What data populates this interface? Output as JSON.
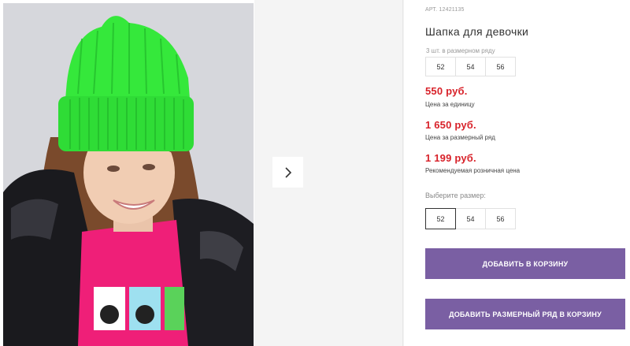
{
  "product": {
    "sku": "АРТ. 12421135",
    "title": "Шапка для девочки"
  },
  "size_set": {
    "caption": "3 шт. в размерном ряду",
    "sizes": [
      "52",
      "54",
      "56"
    ]
  },
  "prices": [
    {
      "value": "550 руб.",
      "note": "Цена за единицу"
    },
    {
      "value": "1 650 руб.",
      "note": "Цена за размерный ряд"
    },
    {
      "value": "1 199 руб.",
      "note": "Рекомендуемая розничная цена"
    }
  ],
  "size_picker": {
    "label": "Выберите размер:",
    "sizes": [
      "52",
      "54",
      "56"
    ],
    "selected": "52"
  },
  "buttons": {
    "add_to_cart": "ДОБАВИТЬ В КОРЗИНУ",
    "add_set_to_cart": "ДОБАВИТЬ РАЗМЕРНЫЙ РЯД В КОРЗИНУ"
  },
  "gallery": {
    "next_icon": "chevron-right-icon"
  },
  "colors": {
    "price": "#d8222a",
    "button": "#7a5fa3",
    "hat": "#33e83a",
    "shirt": "#f0207a"
  }
}
